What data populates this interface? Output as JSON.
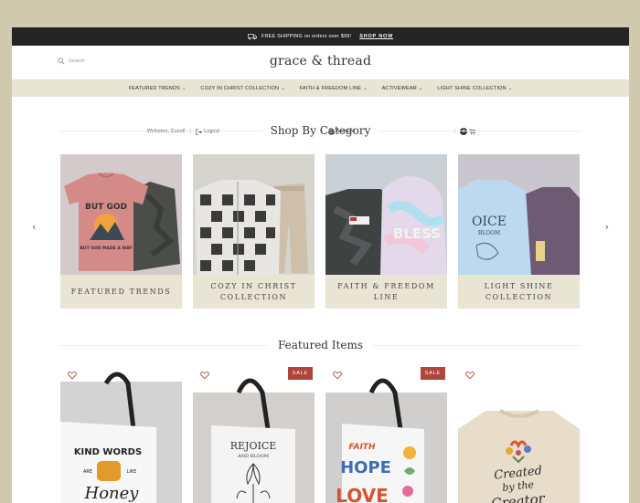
{
  "announcement": {
    "text": "FREE SHIPPING on orders over $99!",
    "link": "SHOP NOW",
    "icon": "truck-icon"
  },
  "header": {
    "search_placeholder": "Search",
    "brand": "grace & thread",
    "welcome": "Welcome, Guest!",
    "logout": "Logout",
    "account": "Account",
    "cart_count": "0"
  },
  "nav": [
    {
      "label": "FEATURED TRENDS"
    },
    {
      "label": "COZY IN CHRIST COLLECTION"
    },
    {
      "label": "FAITH & FREEDOM LINE"
    },
    {
      "label": "ACTIVEWEAR"
    },
    {
      "label": "LIGHT SHINE COLLECTION"
    }
  ],
  "categories": {
    "title": "Shop By Category",
    "items": [
      {
        "label": "FEATURED TRENDS",
        "bg": "#d2c8cb",
        "art_lines": [
          "BUT GOD",
          "BUT GOD MADE A WAY"
        ]
      },
      {
        "label": "COZY IN CHRIST COLLECTION",
        "bg": "#d5d4cc"
      },
      {
        "label": "FAITH & FREEDOM LINE",
        "bg": "#c8cfd5",
        "art_lines": [
          "BLESS"
        ]
      },
      {
        "label": "LIGHT SHINE COLLECTION",
        "bg": "#c9c5cc",
        "art_lines": [
          "OICE",
          "BLOOM"
        ]
      }
    ]
  },
  "featured": {
    "title": "Featured Items",
    "items": [
      {
        "sale": "",
        "art_lines": [
          "KIND WORDS",
          "ARE",
          "LIKE",
          "Honey"
        ]
      },
      {
        "sale": "SALE",
        "art_lines": [
          "REJOICE",
          "AND BLOOM"
        ]
      },
      {
        "sale": "SALE",
        "art_lines": [
          "FAITH",
          "HOPE",
          "LOVE"
        ]
      },
      {
        "sale": "",
        "art_lines": [
          "Created",
          "by the",
          "Creator"
        ]
      }
    ]
  },
  "colors": {
    "topbar": "#242424",
    "nav_bg": "#e9e5d4",
    "sale": "#b0453b",
    "outer_bg": "#cfc9ad"
  }
}
